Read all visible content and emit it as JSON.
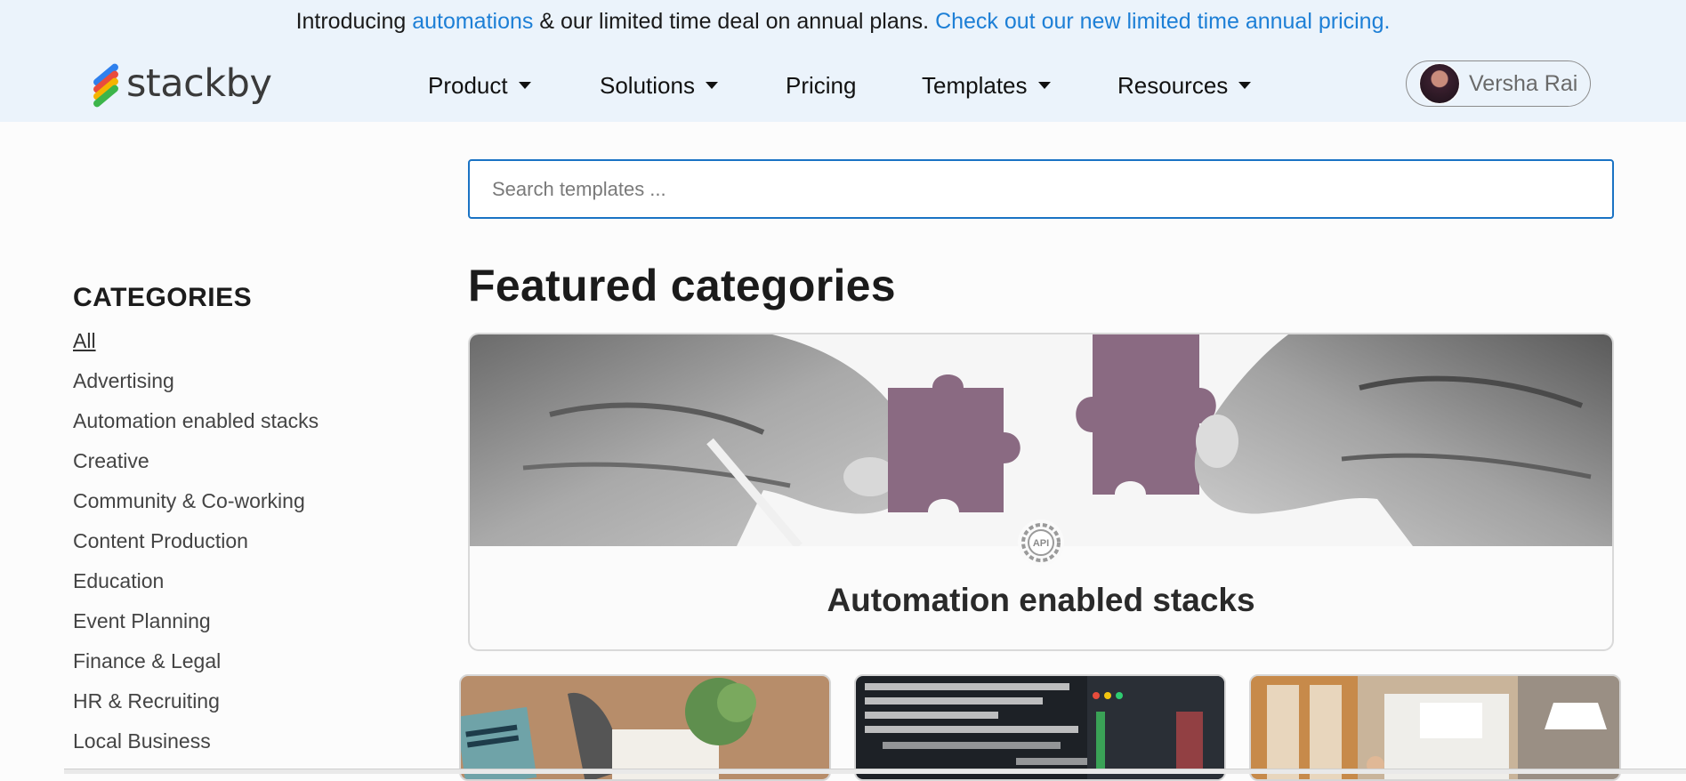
{
  "announcement": {
    "prefix": "Introducing ",
    "automations_link": "automations",
    "middle": " & our limited time deal on annual plans. ",
    "pricing_link": "Check out our new limited time annual pricing."
  },
  "logo": {
    "text": "stackby"
  },
  "nav": {
    "product": "Product",
    "solutions": "Solutions",
    "pricing": "Pricing",
    "templates": "Templates",
    "resources": "Resources"
  },
  "user": {
    "name": "Versha Rai"
  },
  "search": {
    "placeholder": "Search templates ..."
  },
  "sidebar": {
    "title": "CATEGORIES",
    "items": [
      "All",
      "Advertising",
      "Automation enabled stacks",
      "Creative",
      "Community & Co-working",
      "Content Production",
      "Education",
      "Event Planning",
      "Finance & Legal",
      "HR & Recruiting",
      "Local Business"
    ]
  },
  "featured": {
    "title": "Featured categories",
    "card_label": "Automation enabled stacks",
    "badge_text": "API"
  },
  "colors": {
    "link": "#1d7fd6",
    "header_bg": "#ebf3fb",
    "search_border": "#1a73c4",
    "puzzle": "#8a6a82"
  },
  "icons": [
    "stackby-logo-icon",
    "caret-down-icon",
    "avatar",
    "api-gear-icon"
  ]
}
